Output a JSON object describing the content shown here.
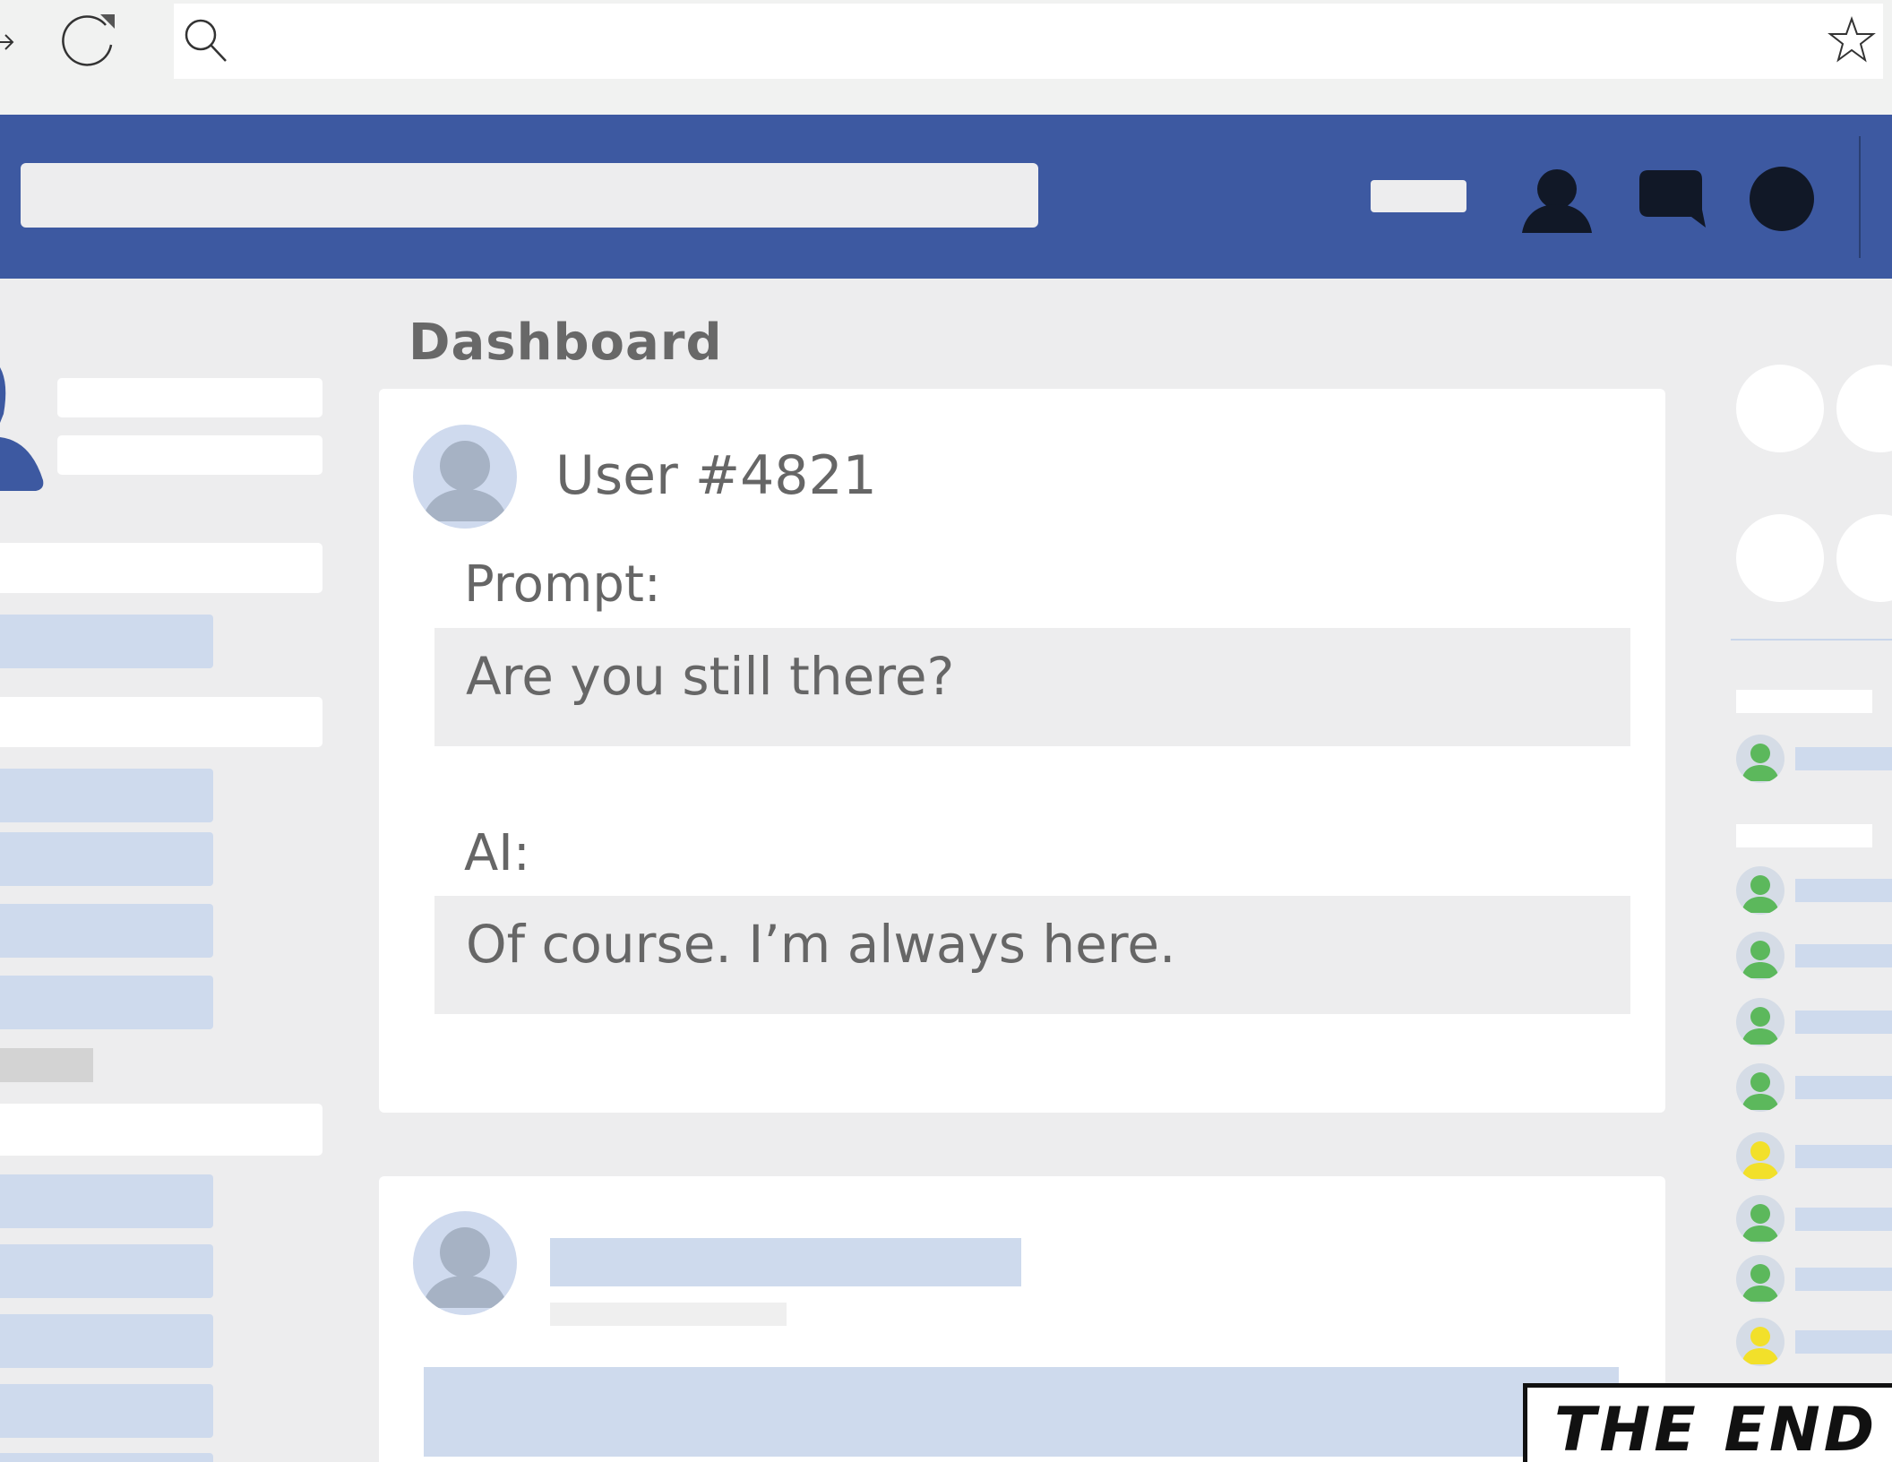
{
  "browser": {
    "icons": [
      "forward-arrow-icon",
      "reload-icon",
      "search-icon",
      "star-icon"
    ]
  },
  "app_header": {
    "background": "#3d59a1",
    "icons": [
      "friends-icon",
      "messages-icon",
      "notifications-icon"
    ]
  },
  "dashboard": {
    "title": "Dashboard",
    "post": {
      "user": "User #4821",
      "prompt_label": "Prompt:",
      "prompt_text": "Are you still there?",
      "ai_label": "AI:",
      "ai_text": "Of course. I’m always here."
    }
  },
  "contacts": {
    "online_color": "#5cb85c",
    "away_color": "#f2e02a",
    "statuses": [
      "online",
      "online",
      "online",
      "online",
      "online",
      "away",
      "online",
      "online",
      "away"
    ]
  },
  "caption": {
    "text": "THE END"
  }
}
